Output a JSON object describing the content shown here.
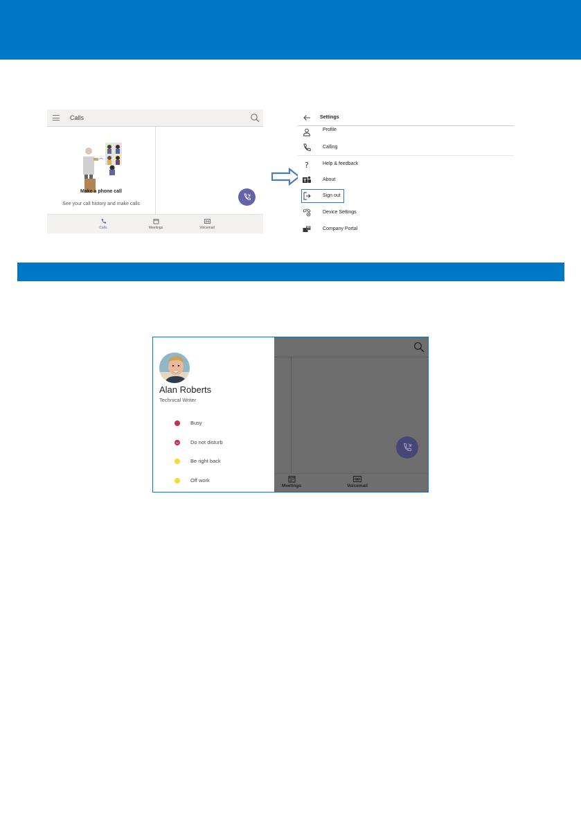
{
  "colors": {
    "brand_blue": "#0078c6",
    "teams_purple": "#6264a7",
    "busy": "#c4314b",
    "dnd": "#c4314b",
    "away": "#fdd835"
  },
  "calls_screen": {
    "header_title": "Calls",
    "menu_icon": "hamburger-icon",
    "search_icon": "search-icon",
    "empty_title": "Make a phone call",
    "empty_subtitle": "See your call history and make calls",
    "fab_icon": "phone-dial-icon",
    "nav": [
      {
        "label": "Calls",
        "icon": "phone-icon",
        "active": true
      },
      {
        "label": "Meetings",
        "icon": "calendar-icon",
        "active": false
      },
      {
        "label": "Voicemail",
        "icon": "voicemail-icon",
        "active": false
      }
    ]
  },
  "settings_screen": {
    "title": "Settings",
    "back_icon": "back-arrow-icon",
    "items": [
      {
        "label": "Profile",
        "icon": "profile-icon"
      },
      {
        "label": "Calling",
        "icon": "phone-icon"
      },
      {
        "label": "Help & feedback",
        "icon": "question-icon"
      },
      {
        "label": "About",
        "icon": "teams-logo-icon"
      },
      {
        "label": "Sign out",
        "icon": "sign-out-icon",
        "highlighted": true
      },
      {
        "label": "Device Settings",
        "icon": "device-settings-icon"
      },
      {
        "label": "Company Portal",
        "icon": "company-portal-icon"
      }
    ]
  },
  "profile_screen": {
    "name": "Alan Roberts",
    "role": "Technical Writer",
    "statuses": [
      {
        "label": "Busy",
        "color": "#c4314b",
        "icon": "busy-dot-icon"
      },
      {
        "label": "Do not disturb",
        "color": "#c4314b",
        "icon": "dnd-icon"
      },
      {
        "label": "Be right back",
        "color": "#fdd835",
        "icon": "away-icon"
      },
      {
        "label": "Off work",
        "color": "#fdd835",
        "icon": "away-icon"
      }
    ],
    "nav": [
      {
        "label": "Meetings",
        "icon": "calendar-icon"
      },
      {
        "label": "Voicemail",
        "icon": "voicemail-icon"
      }
    ]
  }
}
